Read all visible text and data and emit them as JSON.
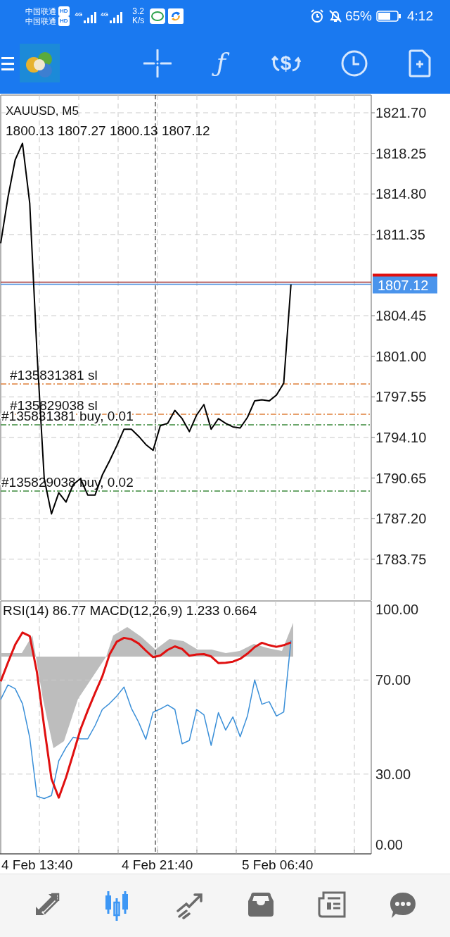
{
  "status_bar": {
    "carriers": [
      {
        "name": "中国联通",
        "badge": "HD"
      },
      {
        "name": "中国联通",
        "badge": "HD"
      }
    ],
    "networks": [
      "4G",
      "4G"
    ],
    "speed_value": "3.2",
    "speed_unit": "K/s",
    "battery_percent": "65%",
    "time": "4:12"
  },
  "toolbar": {
    "function_symbol": "ƒ",
    "trade_symbol": "$"
  },
  "price_chart": {
    "symbol": "XAUUSD, M5",
    "ohlc": "1800.13 1807.27 1800.13 1807.12",
    "price_label": "1807.12",
    "chart_data": {
      "type": "line",
      "categories": [
        null,
        null,
        null,
        null,
        null,
        null,
        null,
        null,
        null,
        null,
        null,
        null,
        null,
        null,
        null,
        null,
        null,
        null,
        null,
        null,
        null,
        null,
        null,
        null,
        null,
        null,
        null,
        null,
        null,
        null,
        null,
        null,
        null,
        null,
        null,
        null,
        null,
        null,
        null,
        null,
        null
      ],
      "series": [
        {
          "color": "#000000",
          "values": [
            1810.6,
            1814.5,
            1817.7,
            1819.1,
            1814.0,
            1801.3,
            1790.6,
            1787.6,
            1789.4,
            1788.6,
            1790.1,
            1790.6,
            1789.2,
            1789.2,
            1790.9,
            1792.1,
            1793.4,
            1794.8,
            1794.8,
            1794.2,
            1793.5,
            1793.0,
            1795.1,
            1795.3,
            1796.4,
            1795.7,
            1794.6,
            1796.0,
            1796.9,
            1794.8,
            1795.7,
            1795.3,
            1795.0,
            1794.9,
            1795.8,
            1797.2,
            1797.3,
            1797.2,
            1797.7,
            1798.7,
            1807.1
          ]
        }
      ],
      "ylim": [
        1780.26,
        1823.32
      ],
      "yticks": [
        {
          "value": 1821.7,
          "label": "1821.70"
        },
        {
          "value": 1818.25,
          "label": "1818.25"
        },
        {
          "value": 1814.8,
          "label": "1814.80"
        },
        {
          "value": 1811.35,
          "label": "1811.35"
        },
        {
          "value": 1804.45,
          "label": "1804.45"
        },
        {
          "value": 1801.0,
          "label": "1801.00"
        },
        {
          "value": 1797.55,
          "label": "1797.55"
        },
        {
          "value": 1794.1,
          "label": "1794.10"
        },
        {
          "value": 1790.65,
          "label": "1790.65"
        },
        {
          "value": 1787.2,
          "label": "1787.20"
        },
        {
          "value": 1783.75,
          "label": "1783.75"
        }
      ],
      "grid": true,
      "ref_lines": [
        {
          "axis": "y",
          "value": 1807.3,
          "color": "#a03030"
        },
        {
          "axis": "y",
          "value": 1807.12,
          "color": "#4d90e0"
        },
        {
          "axis": "y",
          "value": 1798.65,
          "color": "#e0813c",
          "label": "#135831381 sl"
        },
        {
          "axis": "y",
          "value": 1796.07,
          "color": "#e0813c",
          "label": "#135829038 sl"
        },
        {
          "axis": "y",
          "value": 1795.17,
          "color": "#3c8a3c",
          "label": "#135831381 buy, 0.01"
        },
        {
          "axis": "y",
          "value": 1789.54,
          "color": "#3c8a3c",
          "label": "#135829038 buy, 0.02"
        }
      ]
    }
  },
  "indicator_chart": {
    "legend": "RSI(14) 86.77 MACD(12,26,9) 1.233 0.664",
    "chart_data": {
      "type": "line",
      "categories": [
        null,
        null,
        null,
        null,
        null,
        null,
        null,
        null,
        null,
        null,
        null,
        null,
        null,
        null,
        null,
        null,
        null,
        null,
        null,
        null,
        null,
        null,
        null,
        null,
        null,
        null,
        null,
        null,
        null,
        null,
        null,
        null,
        null,
        null,
        null,
        null,
        null,
        null,
        null,
        null,
        null
      ],
      "series": [
        {
          "color": "#3a8fd8",
          "values": [
            61.7,
            67.9,
            66.3,
            59.9,
            45.5,
            20.6,
            19.6,
            20.9,
            35.7,
            41.3,
            45.7,
            45.0,
            45.0,
            50.6,
            57.5,
            60.0,
            63.2,
            67.0,
            58.0,
            52.1,
            44.8,
            56.3,
            57.7,
            59.4,
            57.5,
            42.9,
            44.3,
            57.5,
            55.2,
            42.2,
            56.1,
            48.7,
            54.3,
            45.9,
            54.7,
            70.0,
            59.7,
            60.8,
            54.7,
            56.4,
            86.8
          ]
        },
        {
          "color": "#e01010",
          "values": [
            69.4,
            77.4,
            85.0,
            90.2,
            88.7,
            73.2,
            50.0,
            28.0,
            20.0,
            28.6,
            38.7,
            49.0,
            57.0,
            64.5,
            71.5,
            80.8,
            86.3,
            87.9,
            87.3,
            85.5,
            82.5,
            79.7,
            80.4,
            82.8,
            84.3,
            83.2,
            80.3,
            80.8,
            81.0,
            80.0,
            77.2,
            77.3,
            77.8,
            79.0,
            81.2,
            84.0,
            85.8,
            84.8,
            84.1,
            84.8,
            86.0
          ]
        }
      ],
      "ylim": [
        -3.9,
        103.9
      ],
      "grid": true,
      "yticks": [
        {
          "value": 100,
          "label": "100.00"
        },
        {
          "value": 70,
          "label": "70.00"
        },
        {
          "value": 30,
          "label": "30.00"
        },
        {
          "value": 0,
          "label": "0.00"
        }
      ]
    }
  },
  "bottom_nav": [
    {
      "kind": "quotes",
      "selected": false
    },
    {
      "kind": "chart",
      "selected": true
    },
    {
      "kind": "trade",
      "selected": false
    },
    {
      "kind": "history",
      "selected": false
    },
    {
      "kind": "news",
      "selected": false
    },
    {
      "kind": "messages",
      "selected": false
    }
  ],
  "time_labels": [
    "4 Feb 13:40",
    "4 Feb 21:40",
    "5 Feb 06:40"
  ]
}
